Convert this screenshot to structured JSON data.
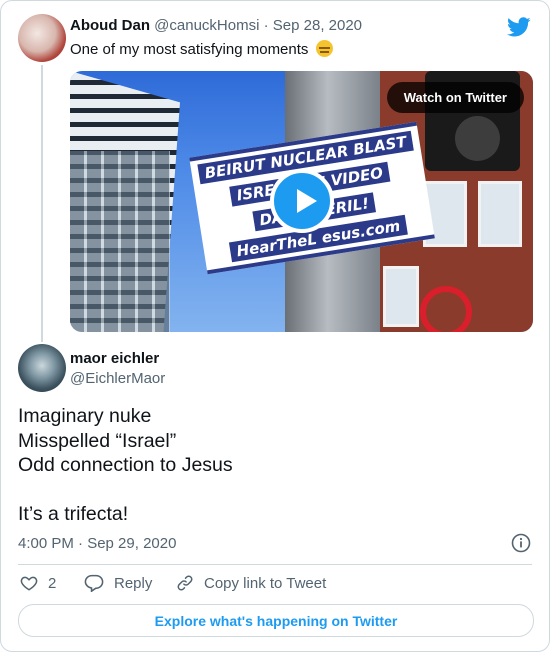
{
  "parent_tweet": {
    "author_name": "Aboud Dan",
    "author_handle": "@canuckHomsi",
    "separator": "·",
    "date": "Sep 28, 2020",
    "text": "One of my most satisfying moments",
    "emoji": "expressionless-face"
  },
  "media": {
    "watch_label": "Watch on Twitter",
    "sign_lines": [
      "BEIRUT NUCLEAR BLAST",
      "ISREAL  ILE VIDEO",
      "DAMA    PERIL!",
      "HearTheL  esus.com"
    ]
  },
  "quoted_tweet": {
    "author_name": "maor eichler",
    "author_handle": "@EichlerMaor",
    "body_lines": [
      "Imaginary nuke",
      "Misspelled “Israel”",
      "Odd connection to Jesus",
      "",
      "It’s a trifecta!"
    ],
    "timestamp": "4:00 PM · Sep 29, 2020"
  },
  "actions": {
    "like_count": "2",
    "reply_label": "Reply",
    "copy_label": "Copy link to Tweet"
  },
  "explore_label": "Explore what's happening on Twitter",
  "colors": {
    "accent": "#1d9bf0",
    "text": "#0f1419",
    "muted": "#536471",
    "border": "#cfd9de"
  }
}
